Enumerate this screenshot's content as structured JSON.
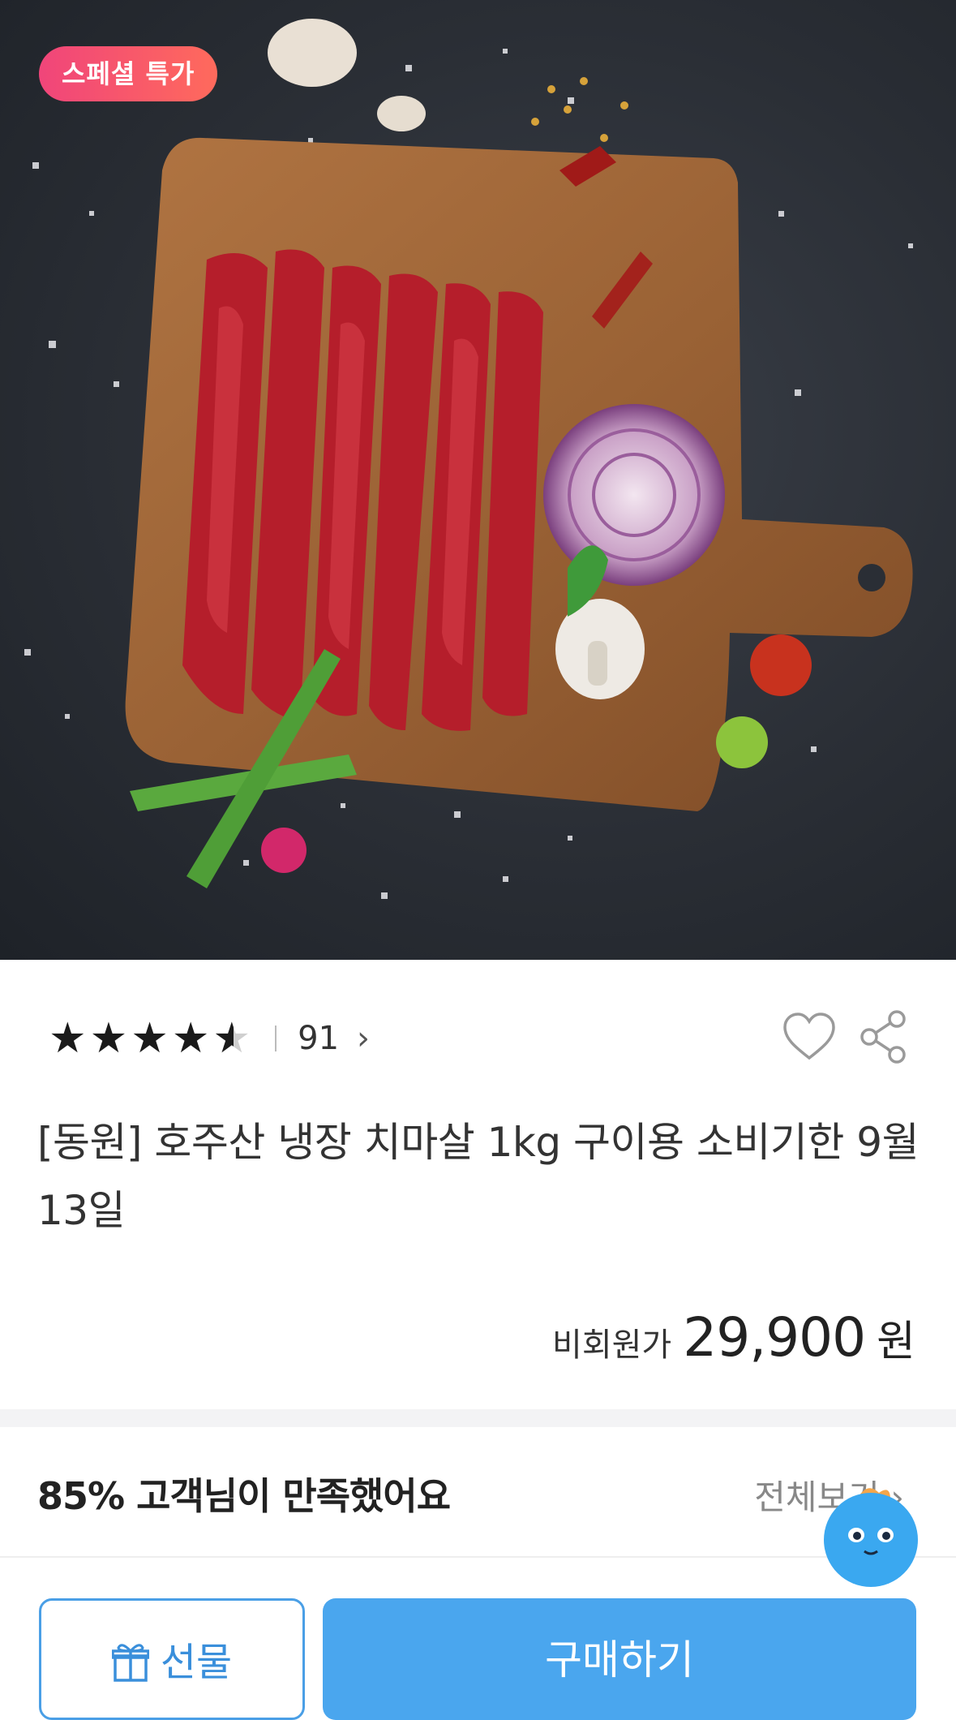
{
  "product": {
    "badge": "스페셜 특가",
    "rating": 4.5,
    "review_count": "91",
    "title": "[동원] 호주산 냉장 치마살 1kg 구이용 소비기한 9월13일",
    "price_label": "비회원가",
    "price": "29,900",
    "price_unit": "원"
  },
  "satisfaction": {
    "text": "85% 고객님이 만족했어요",
    "view_all": "전체보기"
  },
  "actions": {
    "gift_label": "선물",
    "buy_label": "구매하기"
  },
  "icons": {
    "rating_chevron": "chevron-right-icon",
    "wish": "heart-icon",
    "share": "share-icon",
    "gift": "gift-icon",
    "assistant": "mascot-icon"
  },
  "colors": {
    "badge": "#f0457a",
    "primary": "#4aa6ee",
    "gift_outline": "#4a9fe6"
  }
}
